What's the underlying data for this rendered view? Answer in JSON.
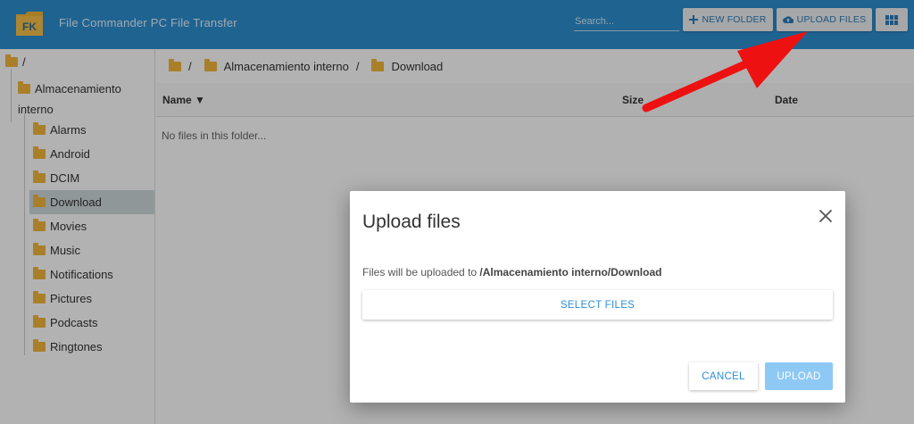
{
  "header": {
    "title": "File Commander PC File Transfer",
    "logo_text": "FK",
    "search_placeholder": "Search...",
    "new_folder_label": "NEW FOLDER",
    "upload_files_label": "UPLOAD FILES",
    "grid_icon": "grid-view-icon"
  },
  "sidebar": {
    "root_label": "/",
    "parent_label_line1": "Almacenamiento",
    "parent_label_line2": "interno",
    "items": [
      {
        "label": "Alarms",
        "selected": false
      },
      {
        "label": "Android",
        "selected": false
      },
      {
        "label": "DCIM",
        "selected": false
      },
      {
        "label": "Download",
        "selected": true
      },
      {
        "label": "Movies",
        "selected": false
      },
      {
        "label": "Music",
        "selected": false
      },
      {
        "label": "Notifications",
        "selected": false
      },
      {
        "label": "Pictures",
        "selected": false
      },
      {
        "label": "Podcasts",
        "selected": false
      },
      {
        "label": "Ringtones",
        "selected": false
      }
    ]
  },
  "breadcrumb": {
    "root": "/",
    "items": [
      "Almacenamiento interno",
      "/",
      "Download"
    ]
  },
  "table": {
    "columns": [
      "Name ▼",
      "Size",
      "Date"
    ],
    "empty_message": "No files in this folder..."
  },
  "dialog": {
    "title": "Upload files",
    "text_prefix": "Files will be uploaded to ",
    "path": "/Almacenamiento interno/Download",
    "select_label": "SELECT FILES",
    "cancel_label": "CANCEL",
    "upload_label": "UPLOAD"
  },
  "colors": {
    "topbar": "#2d8fd0",
    "accent": "#2b8fd6",
    "folder": "#f3b63d",
    "upload_disabled": "#8ec9f5",
    "annotation_arrow": "#ee1111"
  }
}
